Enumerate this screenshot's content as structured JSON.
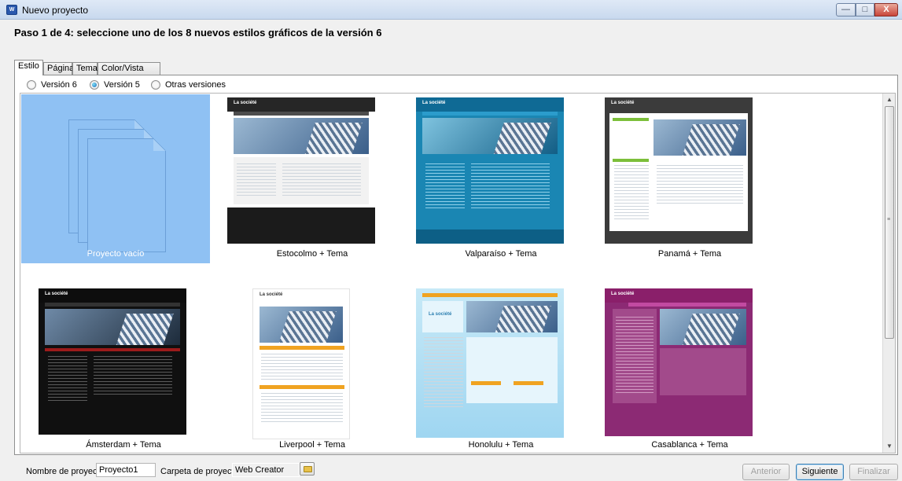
{
  "window": {
    "title": "Nuevo proyecto",
    "icon": "app-icon",
    "controls": {
      "minimize": "—",
      "maximize": "□",
      "close": "X"
    }
  },
  "heading": "Paso 1 de 4:  seleccione uno de los 8 nuevos estilos gráficos de la versión 6",
  "tabs": [
    {
      "label": "Estilo",
      "active": true
    },
    {
      "label": "Página",
      "active": false
    },
    {
      "label": "Tema",
      "active": false
    },
    {
      "label": "Color/Vista previa",
      "active": false
    }
  ],
  "version_options": [
    {
      "label": "Versión 6",
      "checked": false
    },
    {
      "label": "Versión 5",
      "checked": true
    },
    {
      "label": "Otras versiones",
      "checked": false
    }
  ],
  "styles": [
    {
      "caption": "Proyecto vacío",
      "selected": true,
      "kind": "blank"
    },
    {
      "caption": "Estocolmo + Tema",
      "kind": "template",
      "thumb_brand": "La société",
      "head": "#262626",
      "body": "#f2f2f2",
      "accent": "#4a6f8e",
      "foot": "#1b1b1b"
    },
    {
      "caption": "Valparaíso + Tema",
      "kind": "template",
      "thumb_brand": "La société",
      "head": "#0f6a95",
      "body": "#1a86b3",
      "accent": "#2b9ccc",
      "foot": "#0d5f86"
    },
    {
      "caption": "Panamá + Tema",
      "kind": "template",
      "thumb_brand": "La société",
      "head": "#3b3b3b",
      "body": "#ffffff",
      "accent": "#7cbf3a",
      "foot": "#3b3b3b"
    },
    {
      "caption": "Ámsterdam + Tema",
      "kind": "template",
      "thumb_brand": "La société",
      "head": "#0d0d0d",
      "body": "#101010",
      "accent": "#9c1b1b",
      "foot": "#0d0d0d"
    },
    {
      "caption": "Liverpool + Tema",
      "kind": "template",
      "thumb_brand": "La société",
      "head": "#ffffff",
      "body": "#ffffff",
      "accent": "#f0a321",
      "foot": "#ffffff"
    },
    {
      "caption": "Honolulu + Tema",
      "kind": "template",
      "thumb_brand": "La société",
      "head": "#b8e1f5",
      "body": "#c7e9f7",
      "accent": "#f0a321",
      "foot": "#9fd6f1"
    },
    {
      "caption": "Casablanca + Tema",
      "kind": "template",
      "thumb_brand": "La société",
      "head": "#8a1f6a",
      "body": "#8c2a74",
      "accent": "#c24aa1",
      "foot": "#7a1a5e"
    }
  ],
  "footer": {
    "project_name_label": "Nombre de proyecto:",
    "project_name_value": "Proyecto1",
    "projects_folder_label": "Carpeta de proyectos:",
    "projects_folder_value": "Web Creator",
    "buttons": {
      "previous": "Anterior",
      "next": "Siguiente",
      "finish": "Finalizar"
    }
  }
}
